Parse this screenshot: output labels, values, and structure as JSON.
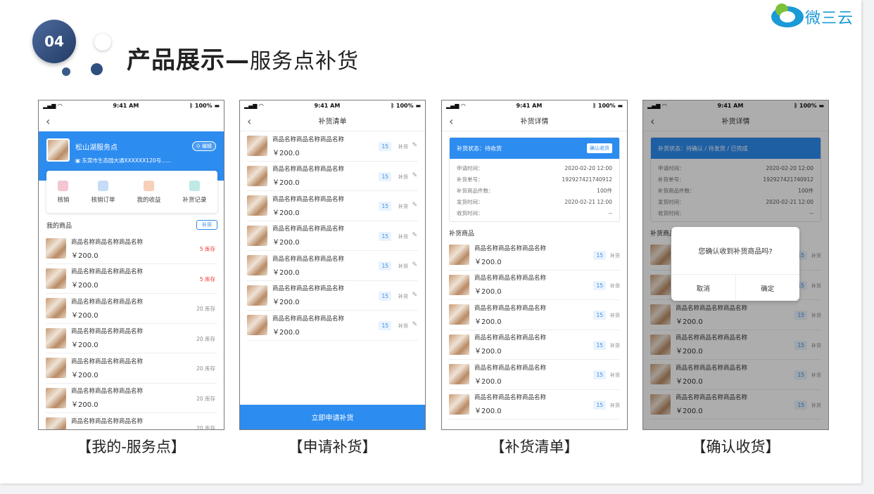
{
  "header": {
    "badge": "04",
    "title_main": "产品展示—",
    "title_sub": "服务点补货",
    "logo_text": "微三云"
  },
  "status": {
    "time": "9:41 AM",
    "battery": "100%"
  },
  "product": {
    "name": "商品名称商品名称商品名称",
    "price": "￥200.0",
    "qty": "15",
    "qty_label": "补货"
  },
  "phone1": {
    "store_name": "松山湖服务点",
    "store_addr": "东莞市生态园大通XXXXXX120号......",
    "edit": "编辑",
    "menu": [
      {
        "label": "核销",
        "icon": "verify-icon",
        "color": "#f3c6d2"
      },
      {
        "label": "核销订单",
        "icon": "order-icon",
        "color": "#c6dcf6"
      },
      {
        "label": "我的收益",
        "icon": "earnings-icon",
        "color": "#f8cfb8"
      },
      {
        "label": "补货记录",
        "icon": "record-icon",
        "color": "#bfe9e4"
      }
    ],
    "section_title": "我的商品",
    "section_btn": "补货",
    "items": [
      {
        "stock": "5 库存",
        "low": true
      },
      {
        "stock": "5 库存",
        "low": true
      },
      {
        "stock": "20 库存",
        "low": false
      },
      {
        "stock": "20 库存",
        "low": false
      },
      {
        "stock": "20 库存",
        "low": false
      },
      {
        "stock": "20 库存",
        "low": false
      },
      {
        "stock": "20 库存",
        "low": false
      }
    ]
  },
  "phone2": {
    "title": "补货清单",
    "footer": "立即申请补货",
    "item_count": 7
  },
  "phone3": {
    "title": "补货详情",
    "status": "补货状态：待收货",
    "confirm": "确认收货",
    "rows": [
      {
        "k": "申请时间：",
        "v": "2020-02-20 12:00"
      },
      {
        "k": "补货单号：",
        "v": "192927421740912"
      },
      {
        "k": "补货商品件数：",
        "v": "100件"
      },
      {
        "k": "发货时间：",
        "v": "2020-02-21 12:00"
      },
      {
        "k": "收货时间：",
        "v": "--"
      }
    ],
    "section": "补货商品"
  },
  "phone4": {
    "title": "补货详情",
    "status": "补货状态：待确认 / 待发货 / 已完成",
    "rows": [
      {
        "k": "申请时间：",
        "v": "2020-02-20 12:00"
      },
      {
        "k": "补货单号：",
        "v": "192927421740912"
      },
      {
        "k": "补货商品件数：",
        "v": "100件"
      },
      {
        "k": "发货时间：",
        "v": "2020-02-21 12:00"
      },
      {
        "k": "收货时间：",
        "v": "--"
      }
    ],
    "section": "补货商品",
    "dialog_q": "您确认收到补货商品吗?",
    "cancel": "取消",
    "ok": "确定"
  },
  "captions": [
    "【我的-服务点】",
    "【申请补货】",
    "【补货清单】",
    "【确认收货】"
  ]
}
